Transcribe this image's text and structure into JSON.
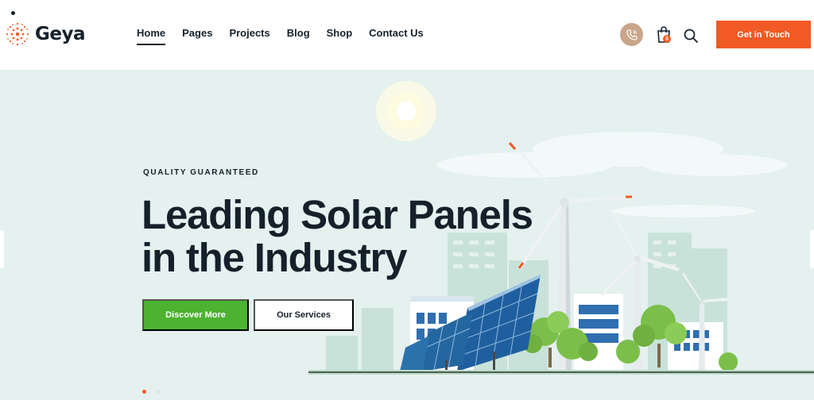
{
  "brand": {
    "name": "Geya"
  },
  "nav": {
    "items": [
      "Home",
      "Pages",
      "Projects",
      "Blog",
      "Shop",
      "Contact Us"
    ],
    "active": "Home"
  },
  "header": {
    "cart_count": "0",
    "cta_label": "Get in Touch",
    "accent": "#f15a24",
    "phone_bg": "#c9a58a"
  },
  "hero": {
    "eyebrow": "QUALITY GUARANTEED",
    "title_line1": "Leading Solar Panels",
    "title_line2": "in the Industry",
    "primary_button": "Discover More",
    "secondary_button": "Our Services",
    "primary_color": "#4cb230",
    "background": "#e4f1ee"
  },
  "slider": {
    "slides": 2,
    "active": 1
  }
}
